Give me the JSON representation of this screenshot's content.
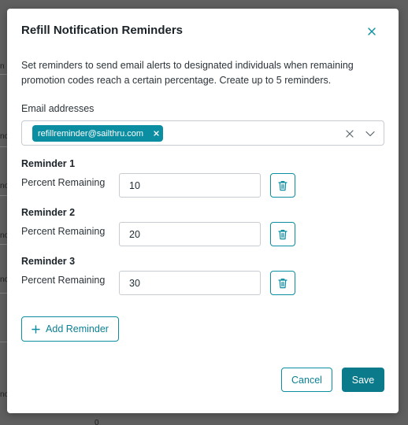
{
  "background": {
    "fragments": [
      "n",
      "no",
      "no",
      "no",
      "no",
      "no",
      "0"
    ]
  },
  "modal": {
    "title": "Refill Notification Reminders",
    "close_icon": "close-icon",
    "description": "Set reminders to send email alerts to designated individuals when remaining promotion codes reach a certain percentage. Create up to 5 reminders.",
    "email_field": {
      "label": "Email addresses",
      "chips": [
        "refillreminder@sailthru.com"
      ]
    },
    "reminders": [
      {
        "heading": "Reminder 1",
        "label": "Percent Remaining",
        "value": "10"
      },
      {
        "heading": "Reminder 2",
        "label": "Percent Remaining",
        "value": "20"
      },
      {
        "heading": "Reminder 3",
        "label": "Percent Remaining",
        "value": "30"
      }
    ],
    "add_button": "Add Reminder",
    "cancel_button": "Cancel",
    "save_button": "Save"
  },
  "colors": {
    "accent": "#0b8ea2",
    "primary_button": "#0b7b8b",
    "overlay": "#5f5f5f"
  }
}
